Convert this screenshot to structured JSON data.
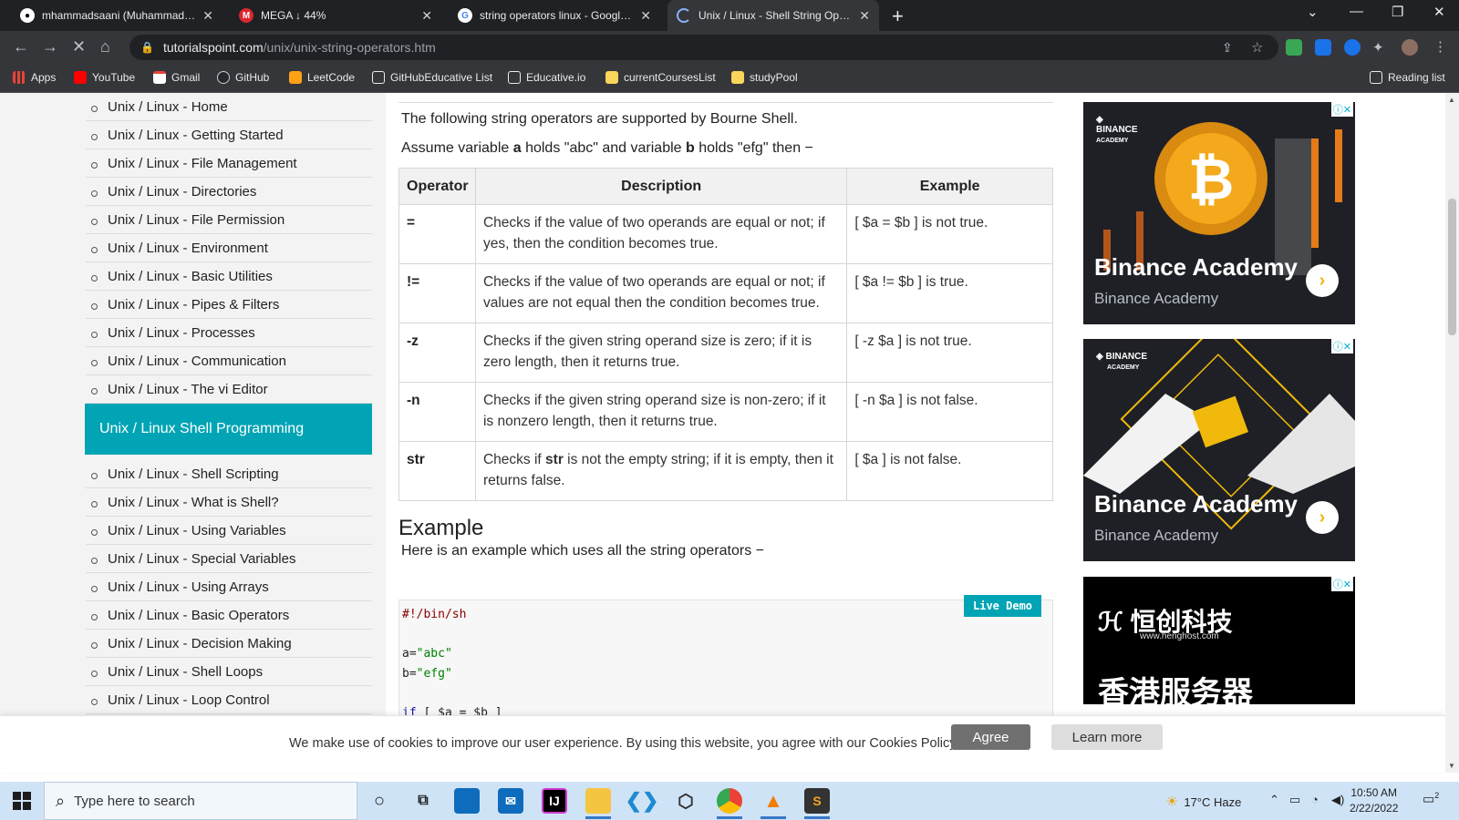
{
  "browser": {
    "tabs": [
      {
        "title": "mhammadsaani (Muhammad Ha",
        "favicon": "github-icon",
        "active": false
      },
      {
        "title": "MEGA ↓ 44%",
        "favicon": "mega-icon",
        "active": false
      },
      {
        "title": "string operators linux - Google S",
        "favicon": "google-icon",
        "active": false
      },
      {
        "title": "Unix / Linux - Shell String Operat",
        "favicon": "loading-icon",
        "active": true
      }
    ],
    "url_domain": "tutorialspoint.com",
    "url_path": "/unix/unix-string-operators.htm",
    "bookmarks": [
      {
        "label": "Apps",
        "icon": "apps-grid-icon"
      },
      {
        "label": "YouTube",
        "icon": "youtube-icon"
      },
      {
        "label": "Gmail",
        "icon": "gmail-icon"
      },
      {
        "label": "GitHub",
        "icon": "github-icon"
      },
      {
        "label": "LeetCode",
        "icon": "leetcode-icon"
      },
      {
        "label": "GitHubEducative List",
        "icon": "page-icon"
      },
      {
        "label": "Educative.io",
        "icon": "page-icon"
      },
      {
        "label": "currentCoursesList",
        "icon": "folder-icon"
      },
      {
        "label": "studyPool",
        "icon": "folder-icon"
      }
    ],
    "reading_list": "Reading list"
  },
  "sidebar": {
    "items_top": [
      "Unix / Linux - Home",
      "Unix / Linux - Getting Started",
      "Unix / Linux - File Management",
      "Unix / Linux - Directories",
      "Unix / Linux - File Permission",
      "Unix / Linux - Environment",
      "Unix / Linux - Basic Utilities",
      "Unix / Linux - Pipes & Filters",
      "Unix / Linux - Processes",
      "Unix / Linux - Communication",
      "Unix / Linux - The vi Editor"
    ],
    "heading": "Unix / Linux Shell Programming",
    "items_bottom": [
      "Unix / Linux - Shell Scripting",
      "Unix / Linux - What is Shell?",
      "Unix / Linux - Using Variables",
      "Unix / Linux - Special Variables",
      "Unix / Linux - Using Arrays",
      "Unix / Linux - Basic Operators",
      "Unix / Linux - Decision Making",
      "Unix / Linux - Shell Loops",
      "Unix / Linux - Loop Control"
    ]
  },
  "content": {
    "intro": "The following string operators are supported by Bourne Shell.",
    "assume_1": "Assume variable ",
    "assume_a": "a",
    "assume_2": " holds \"abc\" and variable ",
    "assume_b": "b",
    "assume_3": " holds \"efg\" then −",
    "table_headers": [
      "Operator",
      "Description",
      "Example"
    ],
    "table_rows": [
      {
        "op": "=",
        "desc": "Checks if the value of two operands are equal or not; if yes, then the condition becomes true.",
        "example": "[ $a = $b ] is not true."
      },
      {
        "op": "!=",
        "desc": "Checks if the value of two operands are equal or not; if values are not equal then the condition becomes true.",
        "example": "[ $a != $b ] is true."
      },
      {
        "op": "-z",
        "desc": "Checks if the given string operand size is zero; if it is zero length, then it returns true.",
        "example": "[ -z $a ] is not true."
      },
      {
        "op": "-n",
        "desc": "Checks if the given string operand size is non-zero; if it is nonzero length, then it returns true.",
        "example": "[ -n $a ] is not false."
      },
      {
        "op": "str",
        "desc_pre": "Checks if ",
        "desc_bold": "str",
        "desc_post": " is not the empty string; if it is empty, then it returns false.",
        "example": "[ $a ] is not false."
      }
    ],
    "example_heading": "Example",
    "example_intro": "Here is an example which uses all the string operators −",
    "live_demo": "Live Demo",
    "code": {
      "shebang": "#!/bin/sh",
      "a_name": "a=",
      "a_val": "\"abc\"",
      "b_name": "b=",
      "b_val": "\"efg\"",
      "if_kw": "if",
      "if_rest": " [ $a = $b ]"
    }
  },
  "ads": [
    {
      "brand": "BINANCE",
      "brand_sub": "ACADEMY",
      "title": "Binance Academy",
      "subtitle": "Binance Academy"
    },
    {
      "brand": "BINANCE",
      "brand_sub": "ACADEMY",
      "title": "Binance Academy",
      "subtitle": "Binance Academy"
    },
    {
      "brand": "恒创科技",
      "brand_sub": "www.henghost.com",
      "title": "香港服务器"
    }
  ],
  "cookie": {
    "text": "We make use of cookies to improve our user experience. By using this website, you agree with our Cookies Policy.",
    "agree": "Agree",
    "learn_more": "Learn more"
  },
  "taskbar": {
    "search_placeholder": "Type here to search",
    "weather": "17°C  Haze",
    "time": "10:50 AM",
    "date": "2/22/2022",
    "notifications": "2"
  },
  "colors": {
    "accent": "#00a4b4",
    "chrome_dark": "#202124",
    "chrome_toolbar": "#35363a",
    "binance_gold": "#f0b90b"
  }
}
